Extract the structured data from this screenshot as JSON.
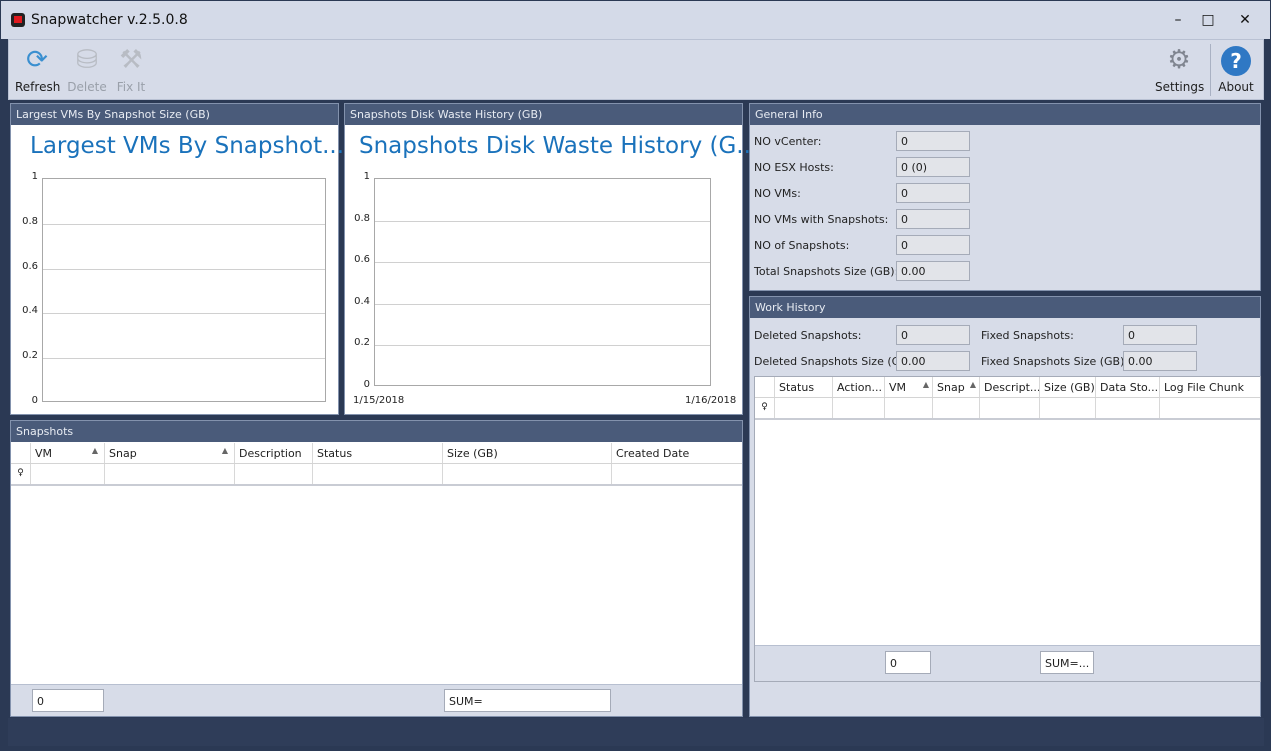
{
  "window": {
    "title": "Snapwatcher v.2.5.0.8",
    "minimize": "–",
    "maximize": "□",
    "close": "✕"
  },
  "toolbar": {
    "refresh": "Refresh",
    "delete": "Delete",
    "fix": "Fix It",
    "settings": "Settings",
    "about": "About"
  },
  "chart1": {
    "panel_title": "Largest VMs By Snapshot Size (GB)",
    "title": "Largest VMs By Snapshot...",
    "yticks": [
      "1",
      "0.8",
      "0.6",
      "0.4",
      "0.2",
      "0"
    ]
  },
  "chart2": {
    "panel_title": "Snapshots Disk Waste History (GB)",
    "title": "Snapshots Disk Waste History (G...",
    "yticks": [
      "1",
      "0.8",
      "0.6",
      "0.4",
      "0.2",
      "0"
    ],
    "xticks": [
      "1/15/2018",
      "1/16/2018"
    ]
  },
  "chart_data": [
    {
      "type": "bar",
      "title": "Largest VMs By Snapshot...",
      "ylim": [
        0,
        1
      ],
      "yticks": [
        0,
        0.2,
        0.4,
        0.6,
        0.8,
        1
      ],
      "values": [],
      "grid": true
    },
    {
      "type": "line",
      "title": "Snapshots Disk Waste History (G...",
      "ylim": [
        0,
        1
      ],
      "xlim": [
        "1/15/2018",
        "1/16/2018"
      ],
      "yticks": [
        0,
        0.2,
        0.4,
        0.6,
        0.8,
        1
      ],
      "values": [],
      "grid": true
    }
  ],
  "snapshots": {
    "panel_title": "Snapshots",
    "columns": [
      "VM",
      "Snap",
      "Description",
      "Status",
      "Size (GB)",
      "Created Date"
    ],
    "count": "0",
    "sum": "SUM="
  },
  "general": {
    "panel_title": "General Info",
    "rows": [
      {
        "label": "NO vCenter:",
        "value": "0"
      },
      {
        "label": "NO ESX Hosts:",
        "value": "0 (0)"
      },
      {
        "label": "NO VMs:",
        "value": "0"
      },
      {
        "label": "NO VMs with Snapshots:",
        "value": "0"
      },
      {
        "label": "NO of Snapshots:",
        "value": "0"
      },
      {
        "label": "Total Snapshots Size (GB):",
        "value": "0.00"
      }
    ]
  },
  "work": {
    "panel_title": "Work History",
    "deleted_label": "Deleted Snapshots:",
    "deleted": "0",
    "deleted_size_label": "Deleted Snapshots Size (GB):",
    "deleted_size": "0.00",
    "fixed_label": "Fixed Snapshots:",
    "fixed": "0",
    "fixed_size_label": "Fixed Snapshots Size (GB):",
    "fixed_size": "0.00",
    "columns": [
      "Status",
      "Action...",
      "VM",
      "Snap",
      "Descript...",
      "Size (GB)",
      "Data Sto...",
      "Log File Chunk"
    ],
    "count": "0",
    "sum": "SUM=..."
  }
}
